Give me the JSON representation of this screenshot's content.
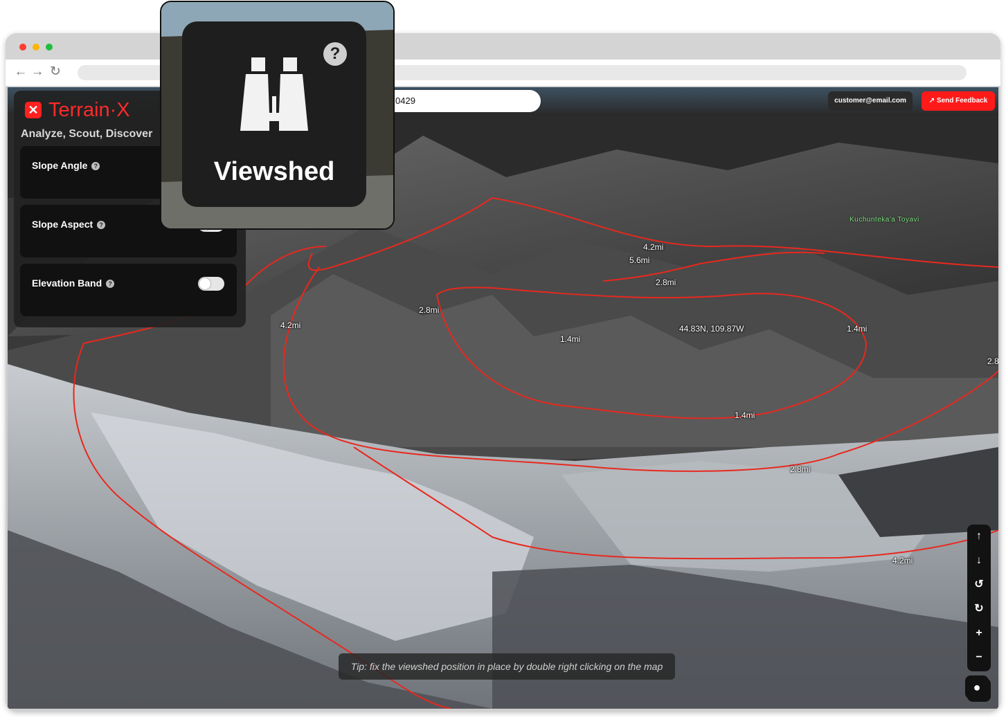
{
  "colors": {
    "accent": "#ff1a1a",
    "viewshed_line": "#e8281e"
  },
  "browser": {
    "dots": [
      "#ff3b30",
      "#ffb400",
      "#1fbf3d"
    ]
  },
  "topbar": {
    "coordinate_value": "0429",
    "user_email": "customer@email.com",
    "feedback_label": "Send Feedback",
    "feedback_icon": "external-link-icon"
  },
  "panel": {
    "brand_name": "Terrain·X",
    "brand_logo_glyph": "✕",
    "tagline": "Analyze, Scout, Discover",
    "tools": [
      {
        "label": "Slope Angle",
        "enabled": false
      },
      {
        "label": "Slope Aspect",
        "enabled": false
      },
      {
        "label": "Elevation Band",
        "enabled": false
      }
    ]
  },
  "map_labels": {
    "ring_42a": "4.2mi",
    "ring_56": "5.6mi",
    "ring_28a": "2.8mi",
    "ring_28b": "2.8mi",
    "ring_42b": "4.2mi",
    "ring_14a": "1.4mi",
    "center_coord": "44.83N, 109.87W",
    "ring_14b": "1.4mi",
    "ring_28c": "2.8",
    "ring_14c": "1.4mi",
    "ring_28d": "2.8mi",
    "ring_42c": "4.2mi",
    "place_name": "Kuchunteka'a Toyavi"
  },
  "controls": {
    "up": "↑",
    "down": "↓",
    "rotate_left": "↺",
    "rotate_right": "↻",
    "zoom_in": "+",
    "zoom_out": "−",
    "recenter": "⌖",
    "globe": "●"
  },
  "tip": "Tip: fix the viewshed position in place by double right clicking on the map",
  "callout": {
    "title": "Viewshed",
    "help_glyph": "?"
  }
}
